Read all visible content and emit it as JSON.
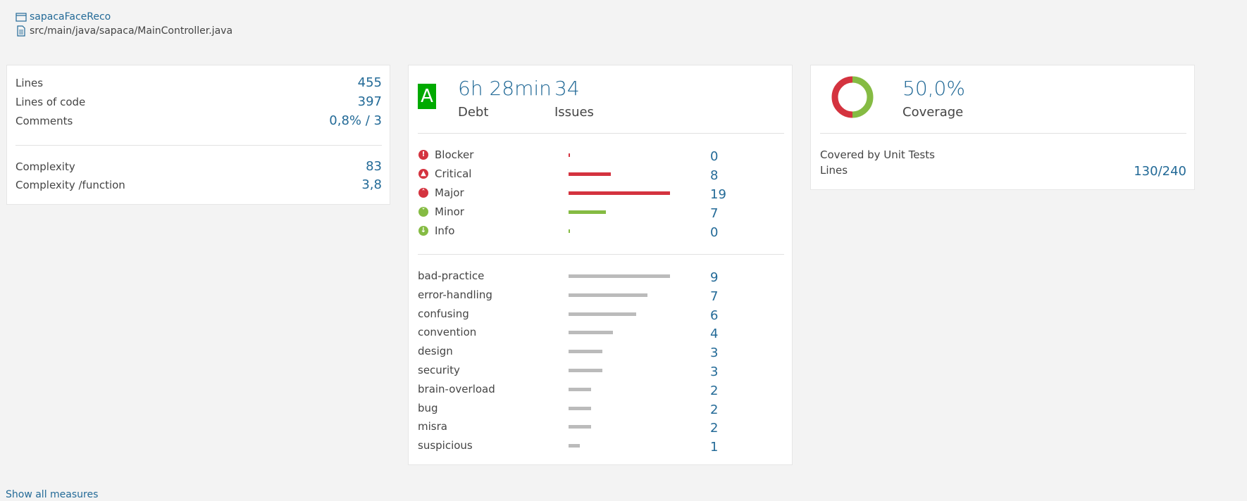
{
  "breadcrumb": {
    "project": "sapacaFaceReco",
    "file": "src/main/java/sapaca/MainController.java"
  },
  "size": {
    "rows": [
      {
        "label": "Lines",
        "value": "455"
      },
      {
        "label": "Lines of code",
        "value": "397"
      },
      {
        "label": "Comments",
        "value": "0,8% / 3"
      }
    ],
    "complexity": [
      {
        "label": "Complexity",
        "value": "83"
      },
      {
        "label": "Complexity /function",
        "value": "3,8"
      }
    ]
  },
  "issues": {
    "rating": "A",
    "debt_value": "6h 28min",
    "debt_label": "Debt",
    "issues_value": "34",
    "issues_label": "Issues",
    "severities": [
      {
        "label": "Blocker",
        "count": "0",
        "fraction": 0.0,
        "color": "#d4333f",
        "icon": "blocker-icon"
      },
      {
        "label": "Critical",
        "count": "8",
        "fraction": 0.42,
        "color": "#d4333f",
        "icon": "critical-icon"
      },
      {
        "label": "Major",
        "count": "19",
        "fraction": 1.0,
        "color": "#d4333f",
        "icon": "major-icon"
      },
      {
        "label": "Minor",
        "count": "7",
        "fraction": 0.37,
        "color": "#85bb43",
        "icon": "minor-icon"
      },
      {
        "label": "Info",
        "count": "0",
        "fraction": 0.0,
        "color": "#85bb43",
        "icon": "info-icon"
      }
    ],
    "tags": [
      {
        "label": "bad-practice",
        "count": "9",
        "fraction": 1.0
      },
      {
        "label": "error-handling",
        "count": "7",
        "fraction": 0.78
      },
      {
        "label": "confusing",
        "count": "6",
        "fraction": 0.67
      },
      {
        "label": "convention",
        "count": "4",
        "fraction": 0.44
      },
      {
        "label": "design",
        "count": "3",
        "fraction": 0.33
      },
      {
        "label": "security",
        "count": "3",
        "fraction": 0.33
      },
      {
        "label": "brain-overload",
        "count": "2",
        "fraction": 0.22
      },
      {
        "label": "bug",
        "count": "2",
        "fraction": 0.22
      },
      {
        "label": "misra",
        "count": "2",
        "fraction": 0.22
      },
      {
        "label": "suspicious",
        "count": "1",
        "fraction": 0.11
      }
    ]
  },
  "coverage": {
    "value": "50,0%",
    "label": "Coverage",
    "fraction": 0.5,
    "covered_color": "#85bb43",
    "uncovered_color": "#d4333f",
    "section_title": "Covered by Unit Tests",
    "lines_label": "Lines",
    "lines_value": "130/240"
  },
  "show_all_label": "Show all measures"
}
